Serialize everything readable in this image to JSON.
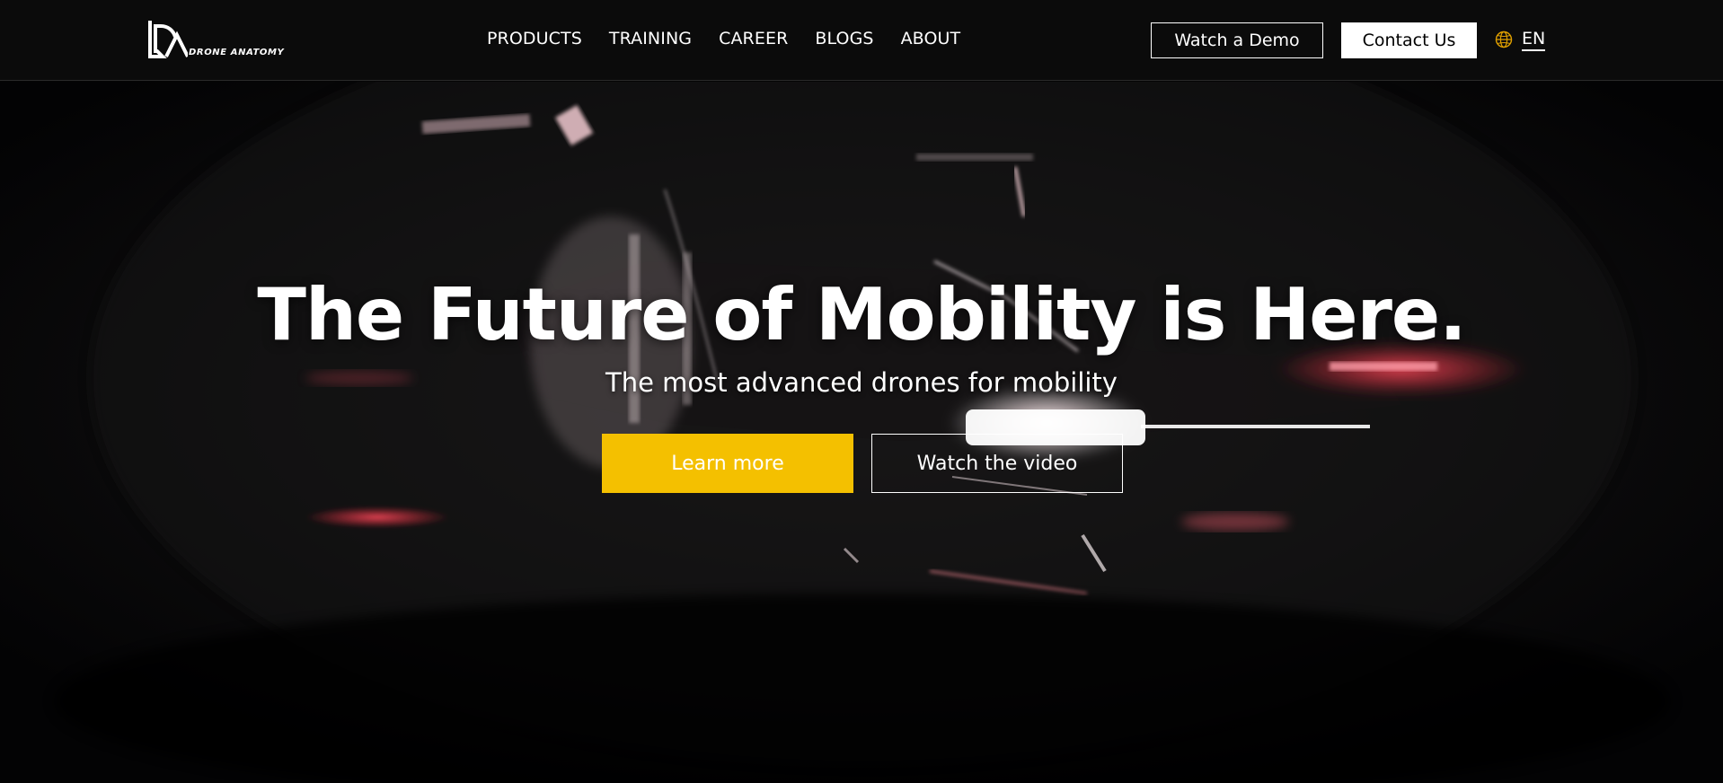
{
  "brand": {
    "name": "DRONE ANATOMY",
    "logo_icon": "drone-anatomy-logo-icon"
  },
  "nav": {
    "items": [
      {
        "label": "PRODUCTS"
      },
      {
        "label": "TRAINING"
      },
      {
        "label": "CAREER"
      },
      {
        "label": "BLOGS"
      },
      {
        "label": "ABOUT"
      }
    ]
  },
  "header_actions": {
    "demo_label": "Watch a Demo",
    "contact_label": "Contact Us",
    "language": {
      "icon": "globe-icon",
      "label": "EN"
    }
  },
  "hero": {
    "title": "The Future of Mobility is Here.",
    "subtitle": "The most advanced drones for mobility",
    "primary_cta": "Learn more",
    "secondary_cta": "Watch the video"
  },
  "colors": {
    "accent": "#f4c000",
    "header_bg": "#0b0b0b",
    "hero_bg": "#040405",
    "globe_icon": "#e0a000"
  }
}
